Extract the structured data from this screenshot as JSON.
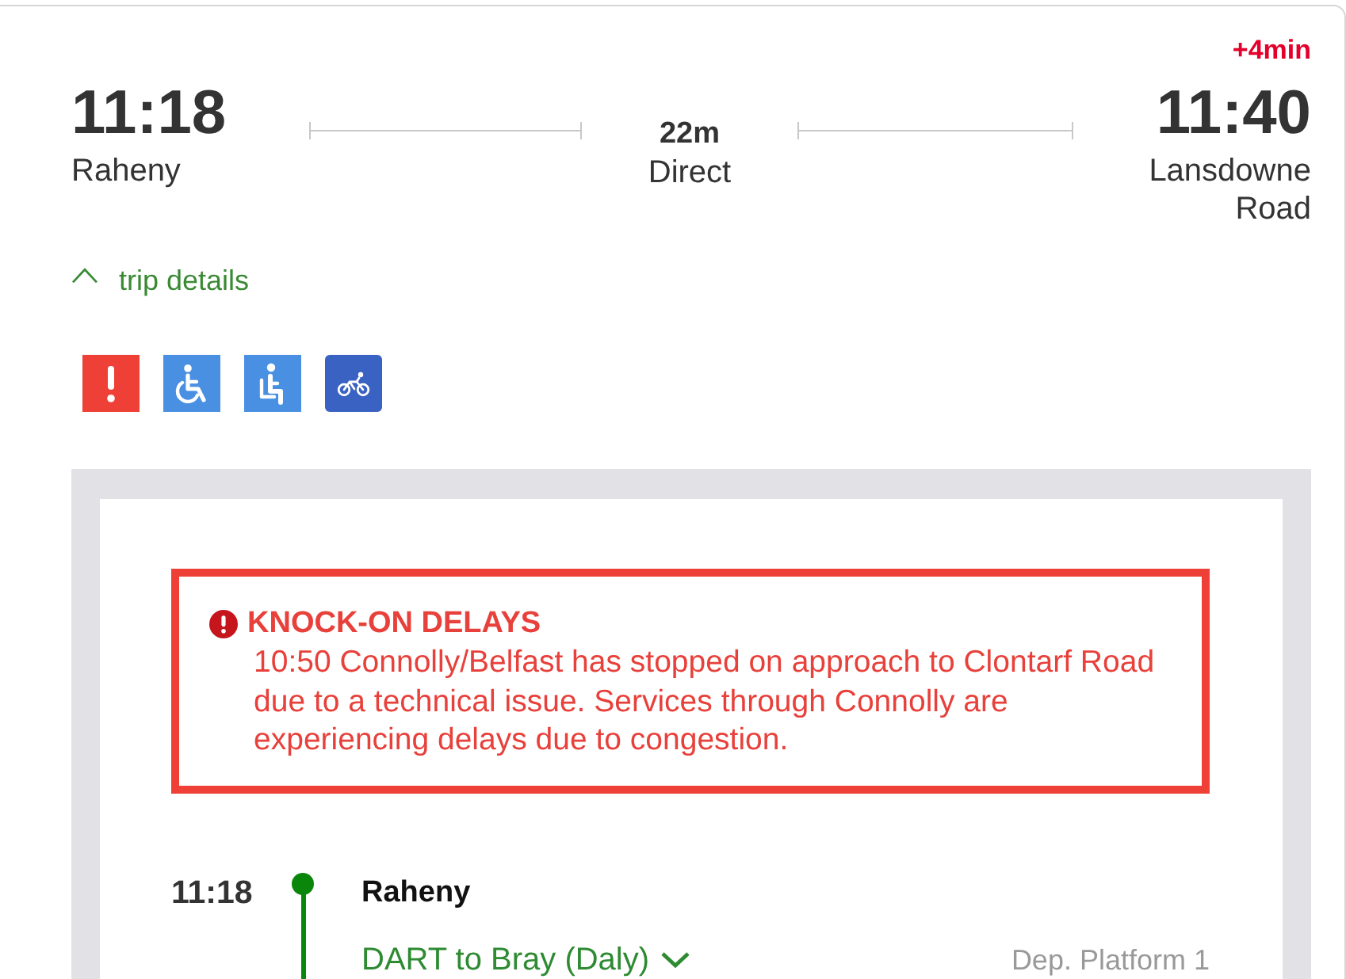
{
  "journey": {
    "departure": {
      "time": "11:18",
      "station": "Raheny"
    },
    "summary": {
      "duration": "22m",
      "type": "Direct"
    },
    "arrival": {
      "delay": "+4min",
      "time": "11:40",
      "station": "Lansdowne Road"
    }
  },
  "trip_details": {
    "label": "trip details",
    "expanded": true
  },
  "features": [
    {
      "kind": "alert"
    },
    {
      "kind": "wheelchair"
    },
    {
      "kind": "seat"
    },
    {
      "kind": "bike"
    }
  ],
  "alert": {
    "title": "KNOCK-ON DELAYS",
    "message": "10:50 Connolly/Belfast has stopped on approach to Clontarf Road due to a technical issue. Services through Connolly are experiencing delays due to congestion."
  },
  "stops": [
    {
      "time": "11:18",
      "station": "Raheny",
      "service": {
        "label": "DART to Bray (Daly)",
        "expanded": false
      },
      "platform": "Dep. Platform 1"
    }
  ]
}
